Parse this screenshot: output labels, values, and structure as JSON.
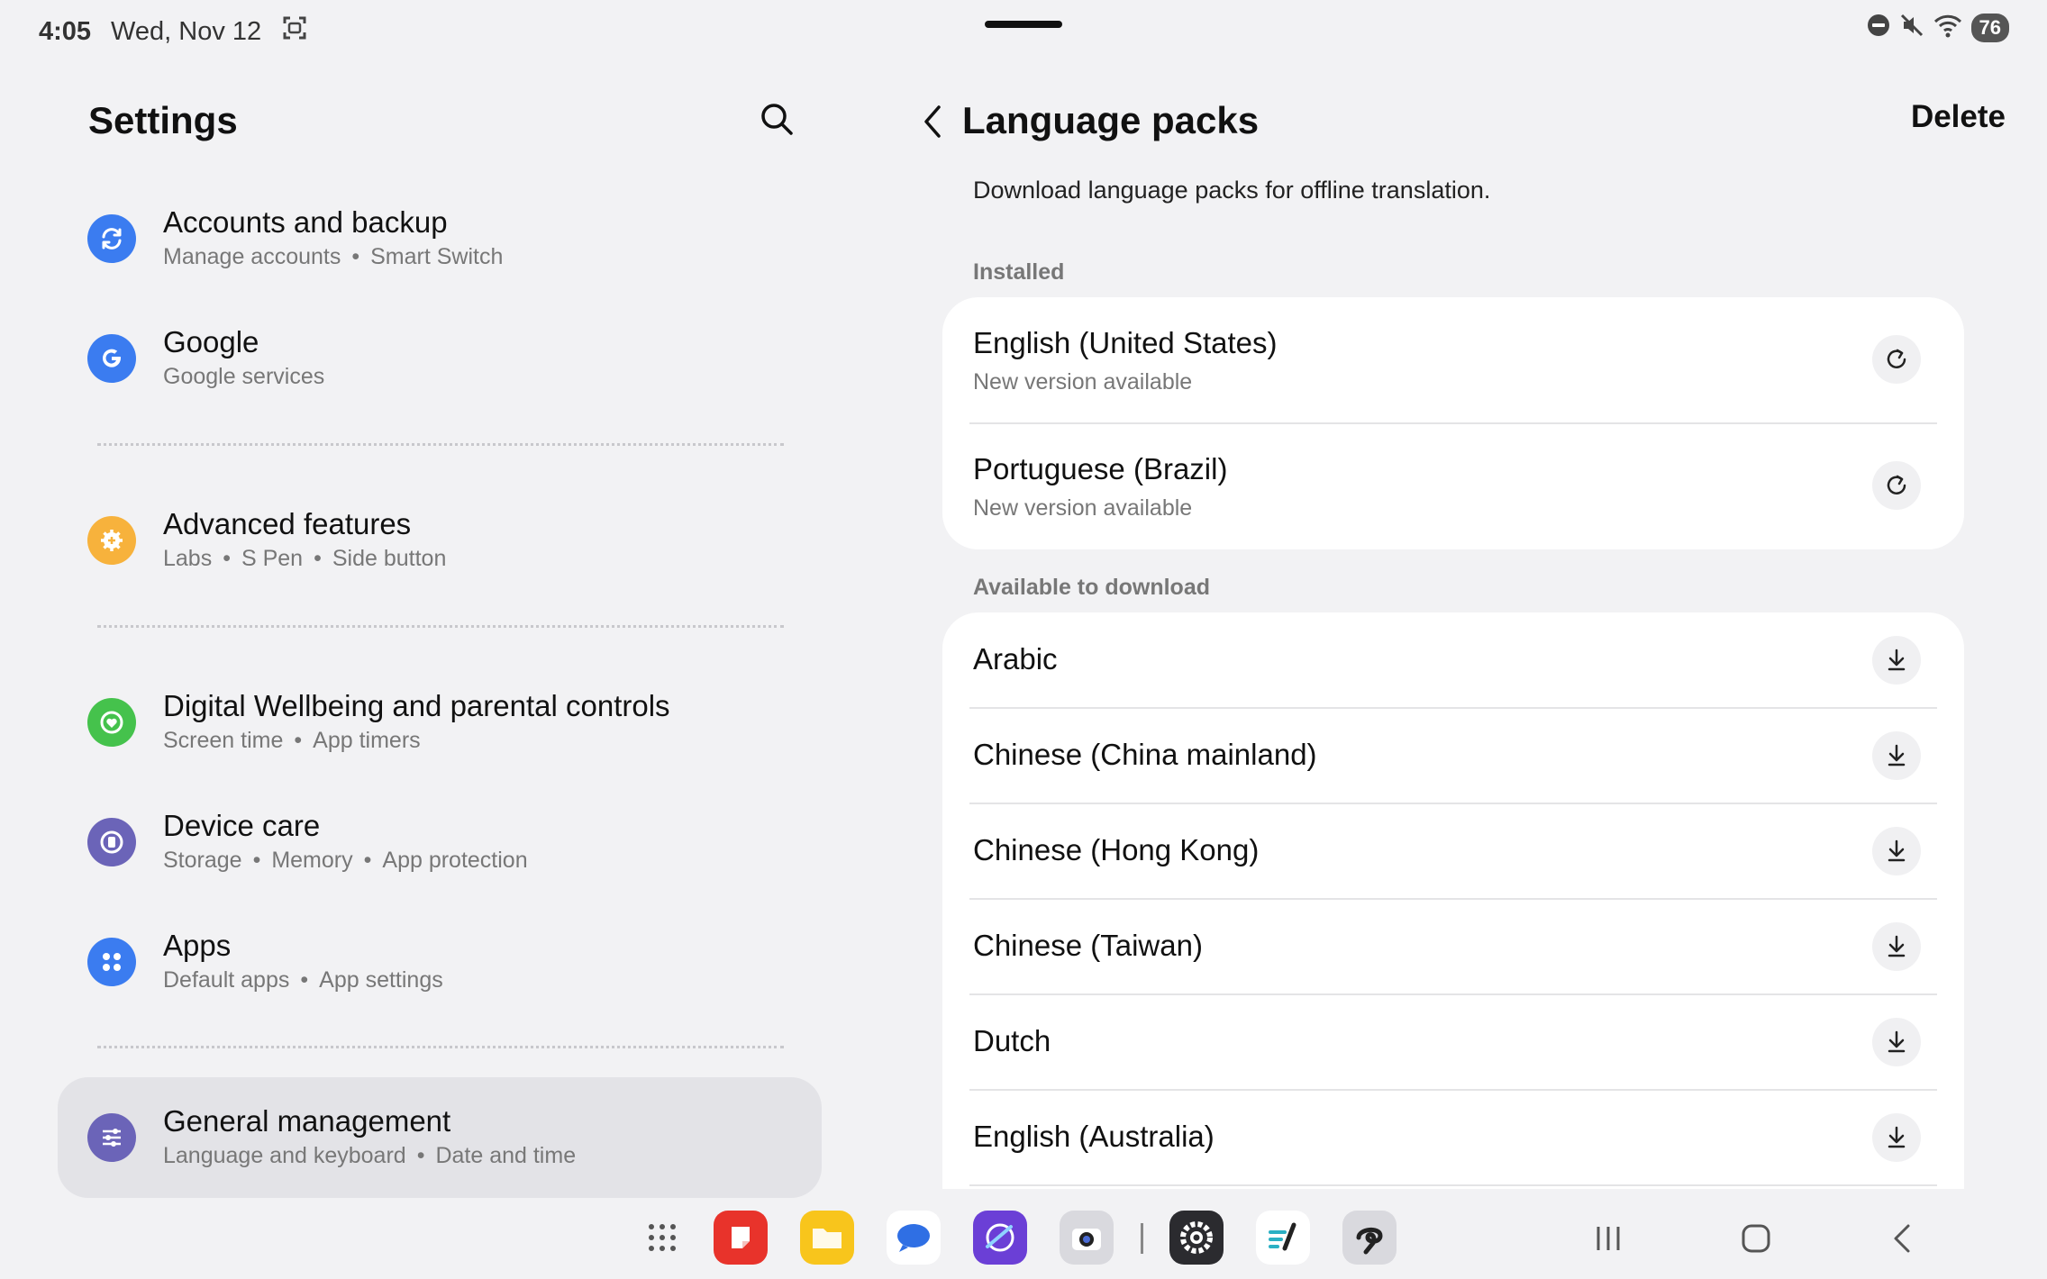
{
  "status_bar": {
    "time": "4:05",
    "date": "Wed, Nov 12",
    "battery": "76"
  },
  "left_pane": {
    "title": "Settings",
    "items": [
      {
        "title": "Accounts and backup",
        "subs": [
          "Manage accounts",
          "Smart Switch"
        ],
        "icon": "sync-icon",
        "color": "#3b7cf0"
      },
      {
        "title": "Google",
        "subs": [
          "Google services"
        ],
        "icon": "google-icon",
        "color": "#3b7cf0"
      },
      {
        "title": "Advanced features",
        "subs": [
          "Labs",
          "S Pen",
          "Side button"
        ],
        "icon": "gear-plus-icon",
        "color": "#f7b23c"
      },
      {
        "title": "Digital Wellbeing and parental controls",
        "subs": [
          "Screen time",
          "App timers"
        ],
        "icon": "heart-ring-icon",
        "color": "#45c24c"
      },
      {
        "title": "Device care",
        "subs": [
          "Storage",
          "Memory",
          "App protection"
        ],
        "icon": "device-care-icon",
        "color": "#6b64b8"
      },
      {
        "title": "Apps",
        "subs": [
          "Default apps",
          "App settings"
        ],
        "icon": "apps-grid-icon",
        "color": "#3b7cf0"
      },
      {
        "title": "General management",
        "subs": [
          "Language and keyboard",
          "Date and time"
        ],
        "icon": "sliders-icon",
        "color": "#6b64b8"
      }
    ]
  },
  "right_pane": {
    "title": "Language packs",
    "delete_label": "Delete",
    "description": "Download language packs for offline translation.",
    "installed_label": "Installed",
    "installed": [
      {
        "name": "English (United States)",
        "status": "New version available"
      },
      {
        "name": "Portuguese (Brazil)",
        "status": "New version available"
      }
    ],
    "available_label": "Available to download",
    "available": [
      {
        "name": "Arabic"
      },
      {
        "name": "Chinese (China mainland)"
      },
      {
        "name": "Chinese (Hong Kong)"
      },
      {
        "name": "Chinese (Taiwan)"
      },
      {
        "name": "Dutch"
      },
      {
        "name": "English (Australia)"
      }
    ]
  },
  "taskbar": {
    "apps": [
      "app-drawer-icon",
      "notes-app-icon",
      "files-app-icon",
      "messages-app-icon",
      "internet-app-icon",
      "camera-app-icon",
      "settings-app-icon",
      "pen-app-icon",
      "sketch-app-icon"
    ]
  }
}
